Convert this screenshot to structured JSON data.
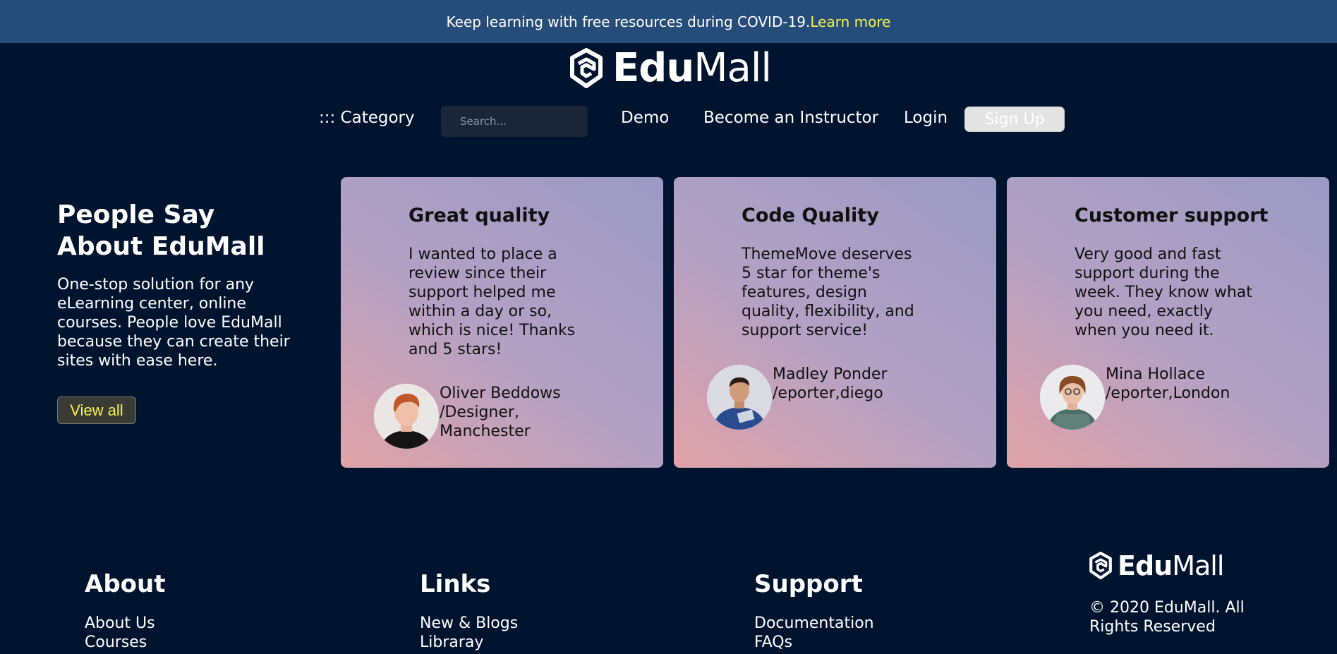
{
  "banner": {
    "text": "Keep learning with free resources during COVID-19.",
    "link": "Learn more"
  },
  "brand": {
    "name_bold": "Edu",
    "name_light": "Mall"
  },
  "nav": {
    "category": "::: Category",
    "search_placeholder": "Search...",
    "demo": "Demo",
    "instructor": "Become an Instructor",
    "login": "Login",
    "signup": "Sign Up"
  },
  "intro": {
    "title_line1": "People Say",
    "title_line2": "About EduMall",
    "text": "One-stop solution for any eLearning center, online courses. People love EduMall because they can create their sites with ease here.",
    "view_all": "View all"
  },
  "testimonials": [
    {
      "title": "Great quality",
      "text": "I wanted to place a review since their support helped me within a day or so, which is nice! Thanks and 5 stars!",
      "author": "Oliver Beddows /Designer, Manchester"
    },
    {
      "title": "Code Quality",
      "text": "ThemeMove deserves 5 star for theme's features, design quality, flexibility, and support service!",
      "author": "Madley Ponder /eporter,diego"
    },
    {
      "title": "Customer support",
      "text": "Very good and fast support during the week. They know what you need, exactly when you need it.",
      "author": "Mina Hollace /eporter,London"
    }
  ],
  "footer": {
    "about": {
      "heading": "About",
      "links": [
        "About Us",
        "Courses"
      ]
    },
    "links": {
      "heading": "Links",
      "links": [
        "New & Blogs",
        "Libraray"
      ]
    },
    "support": {
      "heading": "Support",
      "links": [
        "Documentation",
        "FAQs"
      ]
    },
    "copyright": "© 2020 EduMall. All Rights Reserved"
  },
  "colors": {
    "background": "#01142f",
    "banner": "#264d79",
    "link_accent": "#f6f34a"
  }
}
